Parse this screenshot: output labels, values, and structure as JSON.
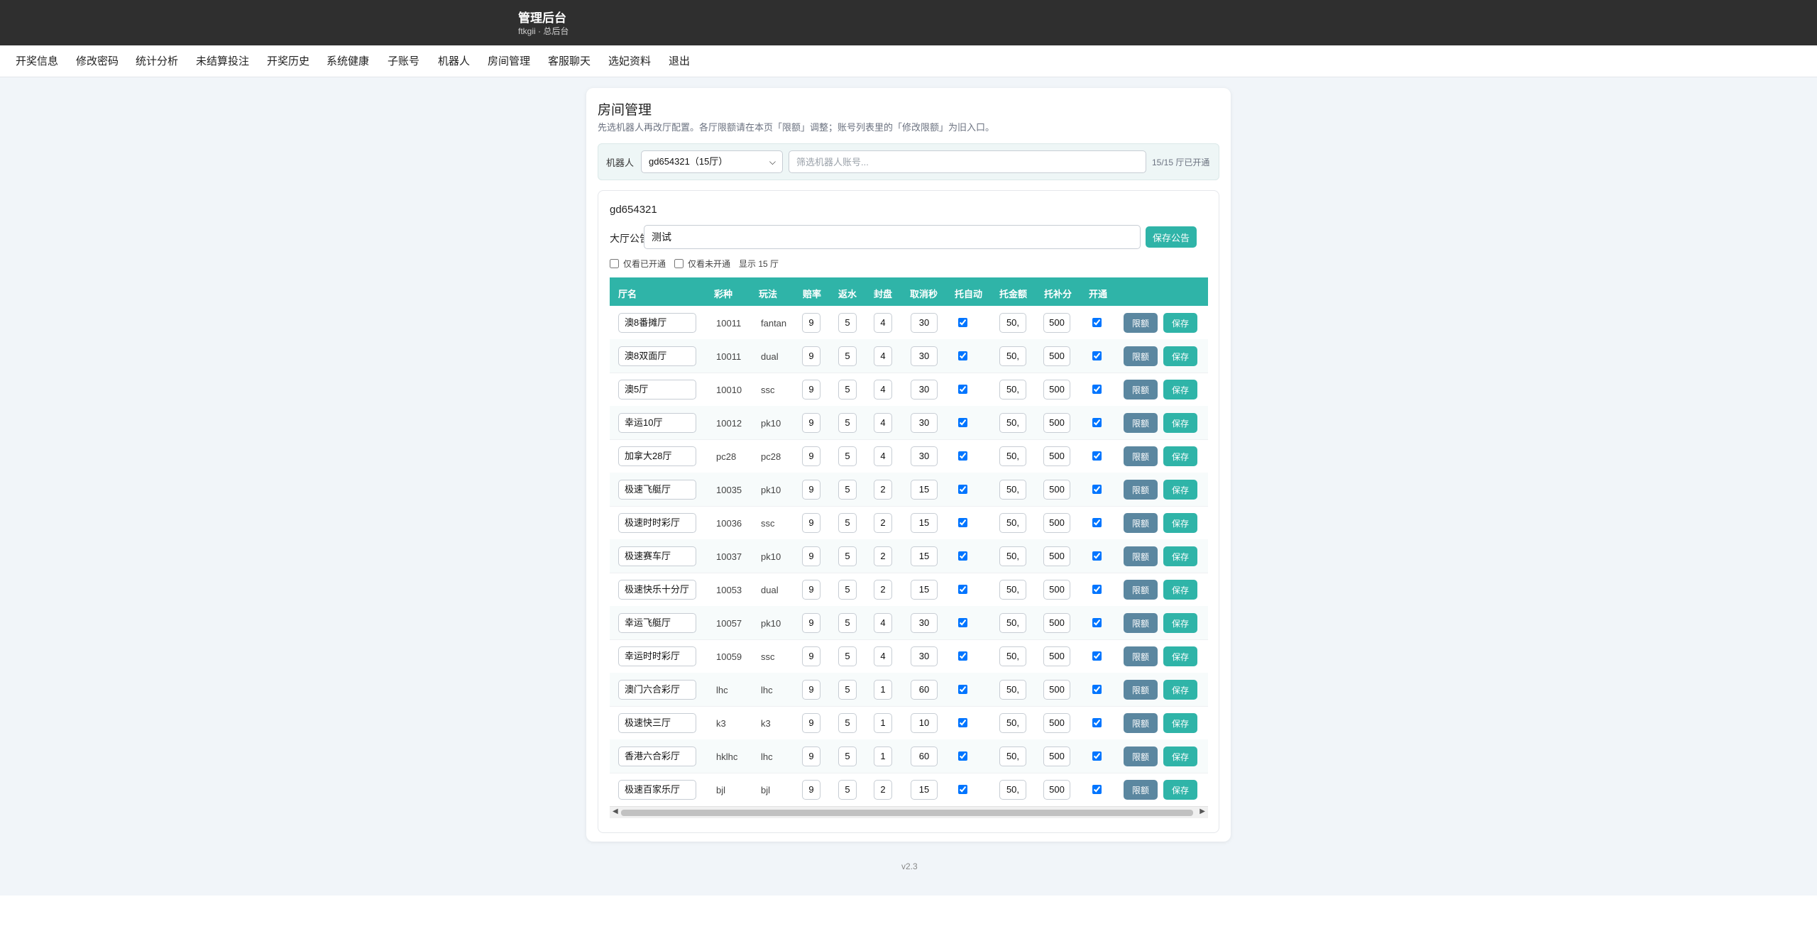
{
  "header": {
    "title": "管理后台",
    "subtitle": "ftkgii · 总后台"
  },
  "nav": {
    "items": [
      "开奖信息",
      "修改密码",
      "统计分析",
      "未结算投注",
      "开奖历史",
      "系统健康",
      "子账号",
      "机器人",
      "房间管理",
      "客服聊天",
      "选妃资料",
      "退出"
    ]
  },
  "page": {
    "title": "房间管理",
    "desc": "先选机器人再改厅配置。各厅限额请在本页「限额」调整；账号列表里的「修改限额」为旧入口。",
    "robot_label": "机器人",
    "robot_selected": "gd654321（15厅）",
    "robot_filter_placeholder": "筛选机器人账号...",
    "open_count": "15/15 厅已开通"
  },
  "panel": {
    "robot_name": "gd654321",
    "announce_label": "大厅公告",
    "announce_value": "测试",
    "save_announce": "保存公告",
    "filter_opened": "仅看已开通",
    "filter_closed": "仅看未开通",
    "showing": "显示 15 厅"
  },
  "table": {
    "headers": [
      "厅名",
      "彩种",
      "玩法",
      "赔率",
      "返水",
      "封盘",
      "取消秒",
      "托自动",
      "托金额",
      "托补分",
      "开通"
    ],
    "btn_limit": "限额",
    "btn_save": "保存",
    "rows": [
      {
        "name": "澳8番摊厅",
        "lottery": "10011",
        "play": "fantan",
        "odds": "9",
        "rebate": "5",
        "seal": "4",
        "cancel": "30",
        "auto": true,
        "amount": "50,",
        "bonus": "500",
        "open": true
      },
      {
        "name": "澳8双面厅",
        "lottery": "10011",
        "play": "dual",
        "odds": "9",
        "rebate": "5",
        "seal": "4",
        "cancel": "30",
        "auto": true,
        "amount": "50,",
        "bonus": "500",
        "open": true
      },
      {
        "name": "澳5厅",
        "lottery": "10010",
        "play": "ssc",
        "odds": "9",
        "rebate": "5",
        "seal": "4",
        "cancel": "30",
        "auto": true,
        "amount": "50,",
        "bonus": "500",
        "open": true
      },
      {
        "name": "幸运10厅",
        "lottery": "10012",
        "play": "pk10",
        "odds": "9",
        "rebate": "5",
        "seal": "4",
        "cancel": "30",
        "auto": true,
        "amount": "50,",
        "bonus": "500",
        "open": true
      },
      {
        "name": "加拿大28厅",
        "lottery": "pc28",
        "play": "pc28",
        "odds": "9",
        "rebate": "5",
        "seal": "4",
        "cancel": "30",
        "auto": true,
        "amount": "50,",
        "bonus": "500",
        "open": true
      },
      {
        "name": "极速飞艇厅",
        "lottery": "10035",
        "play": "pk10",
        "odds": "9",
        "rebate": "5",
        "seal": "2",
        "cancel": "15",
        "auto": true,
        "amount": "50,",
        "bonus": "500",
        "open": true
      },
      {
        "name": "极速时时彩厅",
        "lottery": "10036",
        "play": "ssc",
        "odds": "9",
        "rebate": "5",
        "seal": "2",
        "cancel": "15",
        "auto": true,
        "amount": "50,",
        "bonus": "500",
        "open": true
      },
      {
        "name": "极速赛车厅",
        "lottery": "10037",
        "play": "pk10",
        "odds": "9",
        "rebate": "5",
        "seal": "2",
        "cancel": "15",
        "auto": true,
        "amount": "50,",
        "bonus": "500",
        "open": true
      },
      {
        "name": "极速快乐十分厅",
        "lottery": "10053",
        "play": "dual",
        "odds": "9",
        "rebate": "5",
        "seal": "2",
        "cancel": "15",
        "auto": true,
        "amount": "50,",
        "bonus": "500",
        "open": true
      },
      {
        "name": "幸运飞艇厅",
        "lottery": "10057",
        "play": "pk10",
        "odds": "9",
        "rebate": "5",
        "seal": "4",
        "cancel": "30",
        "auto": true,
        "amount": "50,",
        "bonus": "500",
        "open": true
      },
      {
        "name": "幸运时时彩厅",
        "lottery": "10059",
        "play": "ssc",
        "odds": "9",
        "rebate": "5",
        "seal": "4",
        "cancel": "30",
        "auto": true,
        "amount": "50,",
        "bonus": "500",
        "open": true
      },
      {
        "name": "澳门六合彩厅",
        "lottery": "lhc",
        "play": "lhc",
        "odds": "9",
        "rebate": "5",
        "seal": "1",
        "cancel": "60",
        "auto": true,
        "amount": "50,",
        "bonus": "500",
        "open": true
      },
      {
        "name": "极速快三厅",
        "lottery": "k3",
        "play": "k3",
        "odds": "9",
        "rebate": "5",
        "seal": "1",
        "cancel": "10",
        "auto": true,
        "amount": "50,",
        "bonus": "500",
        "open": true
      },
      {
        "name": "香港六合彩厅",
        "lottery": "hklhc",
        "play": "lhc",
        "odds": "9",
        "rebate": "5",
        "seal": "1",
        "cancel": "60",
        "auto": true,
        "amount": "50,",
        "bonus": "500",
        "open": true
      },
      {
        "name": "极速百家乐厅",
        "lottery": "bjl",
        "play": "bjl",
        "odds": "9",
        "rebate": "5",
        "seal": "2",
        "cancel": "15",
        "auto": true,
        "amount": "50,",
        "bonus": "500",
        "open": true
      }
    ]
  },
  "footer": {
    "version": "v2.3"
  }
}
